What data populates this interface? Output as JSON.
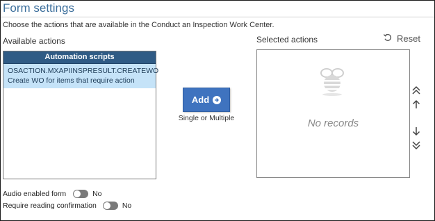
{
  "form": {
    "title": "Form settings",
    "description": "Choose the actions that are available in the Conduct an Inspection Work Center."
  },
  "available": {
    "label": "Available actions",
    "header": "Automation scripts",
    "items": [
      {
        "name": "OSACTION.MXAPIINSPRESULT.CREATEWO",
        "description": "Create WO for items that require action"
      }
    ]
  },
  "add": {
    "label": "Add",
    "icon": "arrow-right-circle-icon",
    "hint": "Single or Multiple"
  },
  "selected": {
    "label": "Selected actions",
    "reset_label": "Reset",
    "empty_text": "No records"
  },
  "order_controls": {
    "icons": [
      "move-to-top-icon",
      "move-up-icon",
      "move-down-icon",
      "move-to-bottom-icon"
    ]
  },
  "toggles": {
    "audio": {
      "label": "Audio enabled form",
      "value": "No",
      "on": false
    },
    "reading": {
      "label": "Require reading confirmation",
      "value": "No",
      "on": false
    }
  },
  "colors": {
    "title": "#3c6f9c",
    "header_bg": "#2f5b85",
    "selection_bg": "#c5e3f8",
    "button_bg": "#3f73bf"
  }
}
